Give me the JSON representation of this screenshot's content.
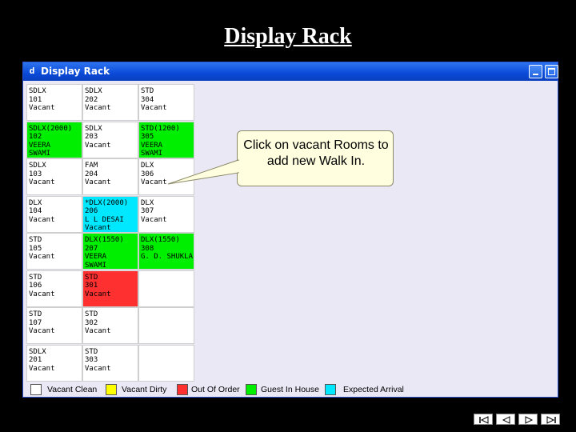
{
  "slide_title": "Display Rack",
  "window": {
    "title": "Display Rack",
    "app_icon": "d"
  },
  "colors": {
    "clean": "#ffffff",
    "dirty": "#ffff00",
    "out_of_order": "#ff3030",
    "guest_in_house": "#00ee00",
    "expected_arrival": "#00e8ff"
  },
  "rooms": [
    {
      "text": "SDLX\n101\nVacant",
      "status": "clean"
    },
    {
      "text": "SDLX\n202\nVacant",
      "status": "clean"
    },
    {
      "text": "STD\n304\nVacant",
      "status": "clean"
    },
    {
      "text": "SDLX(2000)\n102\nVEERA\nSWAMI",
      "status": "guest"
    },
    {
      "text": "SDLX\n203\nVacant",
      "status": "clean"
    },
    {
      "text": "STD(1200)\n305\nVEERA\nSWAMI",
      "status": "guest"
    },
    {
      "text": "SDLX\n103\nVacant",
      "status": "clean"
    },
    {
      "text": "FAM\n204\nVacant",
      "status": "clean"
    },
    {
      "text": "DLX\n306\nVacant",
      "status": "clean"
    },
    {
      "text": "DLX\n104\nVacant",
      "status": "clean"
    },
    {
      "text": "*DLX(2000)\n206\nL L DESAI\nVacant",
      "status": "arrival"
    },
    {
      "text": "DLX\n307\nVacant",
      "status": "clean"
    },
    {
      "text": "STD\n105\nVacant",
      "status": "clean"
    },
    {
      "text": "DLX(1550)\n207\nVEERA\nSWAMI",
      "status": "guest"
    },
    {
      "text": "DLX(1550)\n308\nG. D. SHUKLA",
      "status": "guest"
    },
    {
      "text": "STD\n106\nVacant",
      "status": "clean"
    },
    {
      "text": "STD\n301\nVacant",
      "status": "out"
    },
    {
      "text": "",
      "status": "empty"
    },
    {
      "text": "STD\n107\nVacant",
      "status": "clean"
    },
    {
      "text": "STD\n302\nVacant",
      "status": "clean"
    },
    {
      "text": "",
      "status": "empty"
    },
    {
      "text": "SDLX\n201\nVacant",
      "status": "clean"
    },
    {
      "text": "STD\n303\nVacant",
      "status": "clean"
    },
    {
      "text": "",
      "status": "empty"
    }
  ],
  "callout": {
    "text": "Click on vacant Rooms to add new Walk In."
  },
  "legend": [
    {
      "label": "Vacant Clean",
      "status": "clean"
    },
    {
      "label": "Vacant Dirty",
      "status": "dirty"
    },
    {
      "label": "Out Of Order",
      "status": "out"
    },
    {
      "label": "Guest In House",
      "status": "guest"
    },
    {
      "label": "Expected Arrival",
      "status": "arrival"
    }
  ],
  "nav_icons": [
    "first-slide-icon",
    "previous-slide-icon",
    "next-slide-icon",
    "last-slide-icon"
  ]
}
